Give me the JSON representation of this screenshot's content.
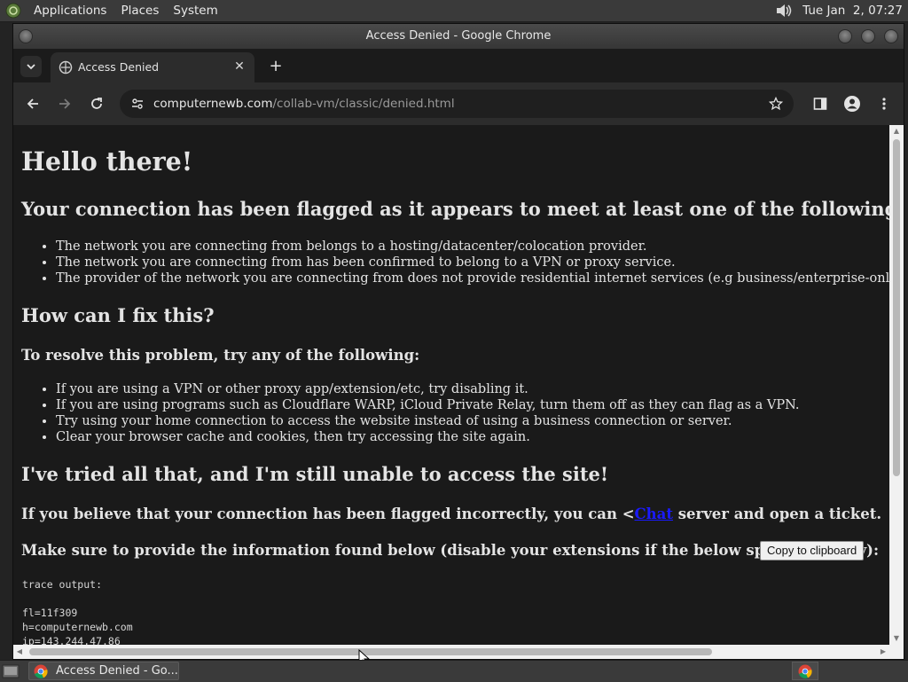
{
  "top_panel": {
    "menus": [
      "Applications",
      "Places",
      "System"
    ],
    "clock": "Tue Jan  2, 07:27",
    "os_icon": "mate-logo-icon",
    "volume_icon": "speaker-icon"
  },
  "window": {
    "title": "Access Denied - Google Chrome"
  },
  "tabs": {
    "active_tab_title": "Access Denied",
    "new_tab_label": "+",
    "close_glyph": "✕"
  },
  "toolbar": {
    "url_host": "computernewb.com",
    "url_path": "/collab-vm/classic/denied.html"
  },
  "page": {
    "h1": "Hello there!",
    "criteria_heading": "Your connection has been flagged as it appears to meet at least one of the following criteria:",
    "criteria": [
      "The network you are connecting from belongs to a hosting/datacenter/colocation provider.",
      "The network you are connecting from has been confirmed to belong to a VPN or proxy service.",
      "The provider of the network you are connecting from does not provide residential internet services (e.g business/enterprise-only networks)."
    ],
    "fix_heading": "How can I fix this?",
    "resolve_heading": "To resolve this problem, try any of the following:",
    "fixes": [
      "If you are using a VPN or other proxy app/extension/etc, try disabling it.",
      "If you are using programs such as Cloudflare WARP, iCloud Private Relay, turn them off as they can flag as a VPN.",
      "Try using your home connection to access the website instead of using a business connection or server.",
      "Clear your browser cache and cookies, then try accessing the site again."
    ],
    "still_heading": "I've tried all that, and I'm still unable to access the site!",
    "flagged_prefix": "If you believe that your connection has been flagged incorrectly, you can <",
    "flagged_link": "Chat",
    "flagged_suffix": " server and open a ticket.",
    "provide_text": "Make sure to provide the information found below (disable your extensions if the below space is empty):",
    "copy_button": "Copy to clipboard",
    "trace_text": "trace output:\n\nfl=11f309\nh=computernewb.com\nip=143.244.47.86"
  },
  "taskbar": {
    "task_label": "Access Denied - Go..."
  },
  "colors": {
    "page_bg": "#1a1a1a",
    "page_text": "#e4e4e4",
    "link": "#1a1aff",
    "chrome_toolbar": "#2c2c2c",
    "panel": "#3a3a3a"
  }
}
